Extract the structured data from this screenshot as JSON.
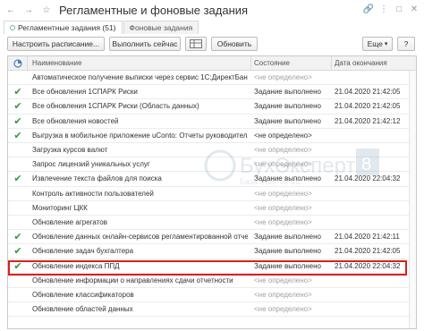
{
  "title": "Регламентные и фоновые задания",
  "tabs": [
    {
      "label": "Регламентные задания (51)"
    },
    {
      "label": "Фоновые задания"
    }
  ],
  "toolbar": {
    "schedule": "Настроить расписание...",
    "run_now": "Выполнить сейчас",
    "refresh": "Обновить",
    "more": "Еще",
    "help": "?"
  },
  "columns": {
    "name": "Наименование",
    "state": "Состояние",
    "end_date": "Дата окончания"
  },
  "rows": [
    {
      "done": false,
      "name": "Автоматическое получение выписки через сервис 1С:ДиректБанк",
      "state": "<не определено>",
      "date": ""
    },
    {
      "done": true,
      "name": "Все обновления 1СПАРК Риски",
      "state": "Задание выполнено",
      "date": "21.04.2020 21:42:05"
    },
    {
      "done": true,
      "name": "Все обновления 1СПАРК Риски (Область данных)",
      "state": "Задание выполнено",
      "date": "21.04.2020 21:42:05"
    },
    {
      "done": true,
      "name": "Все обновления новостей",
      "state": "Задание выполнено",
      "date": "21.04.2020 21:42:12"
    },
    {
      "done": true,
      "name": "Выгрузка в мобильное приложение uConto: Отчеты руководителя",
      "state": "<не определено>",
      "date": ""
    },
    {
      "done": false,
      "name": "Загрузка курсов валют",
      "state": "<не определено>",
      "date": ""
    },
    {
      "done": false,
      "name": "Запрос лицензий уникальных услуг",
      "state": "<не определено>",
      "date": ""
    },
    {
      "done": true,
      "name": "Извлечение текста файлов для поиска",
      "state": "Задание выполнено",
      "date": "21.04.2020 22:04:32"
    },
    {
      "done": false,
      "name": "Контроль активности пользователей",
      "state": "<не определено>",
      "date": ""
    },
    {
      "done": false,
      "name": "Мониторинг ЦКК",
      "state": "<не определено>",
      "date": ""
    },
    {
      "done": false,
      "name": "Обновление агрегатов",
      "state": "<не определено>",
      "date": ""
    },
    {
      "done": true,
      "name": "Обновление данных онлайн-сервисов регламентированной отчет...",
      "state": "Задание выполнено",
      "date": "21.04.2020 21:42:11"
    },
    {
      "done": true,
      "name": "Обновление задач бухгалтера",
      "state": "Задание выполнено",
      "date": "21.04.2020 21:42:05"
    },
    {
      "done": true,
      "name": "Обновление индекса ППД",
      "state": "Задание выполнено",
      "date": "21.04.2020 22:04:32"
    },
    {
      "done": false,
      "name": "Обновление информации о направлениях сдачи отчетности",
      "state": "<не определено>",
      "date": ""
    },
    {
      "done": false,
      "name": "Обновление классификаторов",
      "state": "<не определено>",
      "date": ""
    },
    {
      "done": false,
      "name": "Обновление областей данных",
      "state": "<не определено>",
      "date": ""
    }
  ],
  "watermark": {
    "brand": "БухЭксперт",
    "num": "8",
    "subtitle": "База ответов 1С"
  },
  "colors": {
    "check": "#2e9a3a",
    "highlight": "#d9201c"
  }
}
